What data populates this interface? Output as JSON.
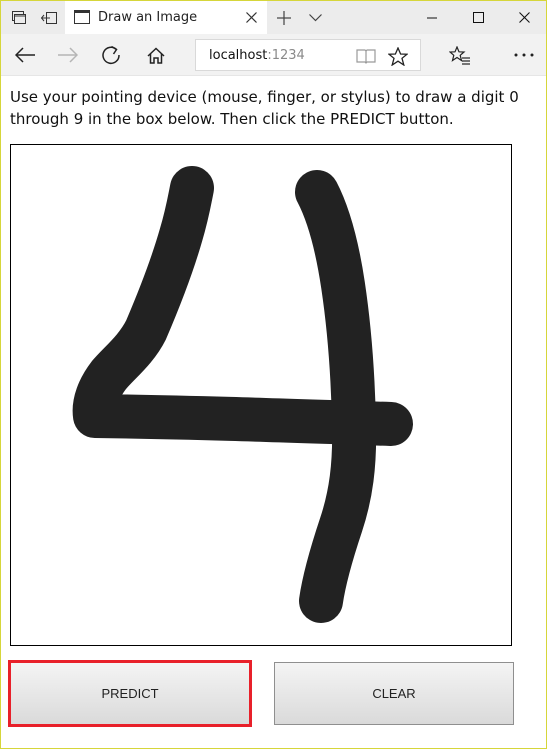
{
  "browser": {
    "tab_title": "Draw an Image",
    "address_host": "localhost",
    "address_port": ":1234"
  },
  "page": {
    "instructions": "Use your pointing device (mouse, finger, or stylus) to draw a digit 0 through 9 in the box below. Then click the PREDICT button.",
    "predict_label": "PREDICT",
    "clear_label": "CLEAR",
    "highlight_color": "#e8202a",
    "stroke_color": "#222222"
  },
  "icons": [
    "tab-manager-icon",
    "set-aside-tabs-icon",
    "page-icon",
    "close-icon",
    "plus-icon",
    "chevron-down-icon",
    "minimize-icon",
    "maximize-icon",
    "close-window-icon",
    "back-arrow-icon",
    "forward-arrow-icon",
    "refresh-icon",
    "home-icon",
    "reading-view-icon",
    "favorite-star-icon",
    "favorites-hub-icon",
    "more-icon"
  ]
}
